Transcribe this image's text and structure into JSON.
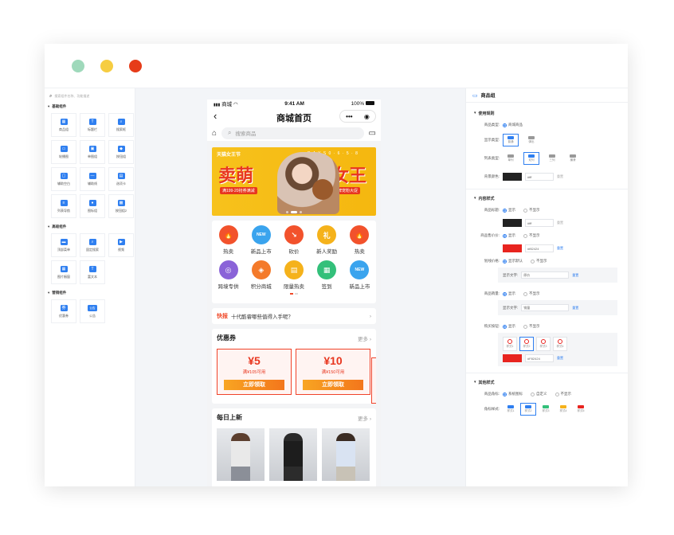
{
  "window": {
    "traffic_lights": [
      "#9fd9bb",
      "#f6cd42",
      "#e63c19"
    ]
  },
  "left_panel": {
    "search_placeholder": "搜索组件名称、功能描述",
    "sections": [
      {
        "title": "基础组件",
        "items": [
          {
            "label": "商品组",
            "glyph": "▦"
          },
          {
            "label": "标题栏",
            "glyph": "T"
          },
          {
            "label": "搜索框",
            "glyph": "⌕"
          },
          {
            "label": "轮播图",
            "glyph": "▭"
          },
          {
            "label": "单图组",
            "glyph": "▣"
          },
          {
            "label": "按钮组",
            "glyph": "◆"
          },
          {
            "label": "辅助空白",
            "glyph": "▢"
          },
          {
            "label": "辅助线",
            "glyph": "―"
          },
          {
            "label": "选项卡",
            "glyph": "▤"
          },
          {
            "label": "列表导航",
            "glyph": "≡"
          },
          {
            "label": "图标组",
            "glyph": "●"
          },
          {
            "label": "按钮组2",
            "glyph": "▩"
          }
        ]
      },
      {
        "title": "高级组件",
        "items": [
          {
            "label": "顶部菜单",
            "glyph": "▬"
          },
          {
            "label": "固定搜索",
            "glyph": "⌕"
          },
          {
            "label": "视频",
            "glyph": "▶"
          },
          {
            "label": "图片橱窗",
            "glyph": "▦"
          },
          {
            "label": "富文本",
            "glyph": "T"
          }
        ]
      },
      {
        "title": "营销组件",
        "items": [
          {
            "label": "优惠券",
            "glyph": "券"
          },
          {
            "label": "公告",
            "glyph": "公告"
          }
        ]
      }
    ]
  },
  "phone": {
    "status": {
      "carrier": "商城",
      "time": "9:41 AM",
      "battery": "100%"
    },
    "nav_title": "商城首页",
    "search_placeholder": "搜索商品",
    "banner": {
      "brand": "天猫女王节",
      "dates": "D A Y S 0 · 6 · 5 · 8",
      "big_left": "卖萌",
      "big_right": "女王",
      "tag_left": "满199-20抢券满减",
      "tag_right": "大牌宠粉大促"
    },
    "icons": [
      [
        {
          "label": "热卖",
          "color": "#f2522c",
          "glyph": "🔥"
        },
        {
          "label": "新品上市",
          "color": "#3aa4ee",
          "glyph": "NEW"
        },
        {
          "label": "砍价",
          "color": "#f2522c",
          "glyph": "↘"
        },
        {
          "label": "新人奖励",
          "color": "#f5b21b",
          "glyph": "礼"
        },
        {
          "label": "热卖",
          "color": "#f2522c",
          "glyph": "🔥"
        }
      ],
      [
        {
          "label": "跨境专供",
          "color": "#8a63d8",
          "glyph": "◎"
        },
        {
          "label": "积分商城",
          "color": "#f47a2a",
          "glyph": "◈"
        },
        {
          "label": "限量热卖",
          "color": "#f5b21b",
          "glyph": "▤"
        },
        {
          "label": "签到",
          "color": "#33c07a",
          "glyph": "▦"
        },
        {
          "label": "新品上市",
          "color": "#3aa4ee",
          "glyph": "NEW"
        }
      ]
    ],
    "notice": {
      "tag": "快报",
      "text": "十代酷睿哪些值得入手呢？"
    },
    "coupon_section": {
      "title": "优惠券",
      "more": "更多",
      "coupons": [
        {
          "amount": "¥5",
          "condition": "满¥105可用",
          "button": "立即领取"
        },
        {
          "amount": "¥10",
          "condition": "满¥150可用",
          "button": "立即领取"
        }
      ]
    },
    "new_section": {
      "title": "每日上新",
      "more": "更多"
    }
  },
  "right_panel": {
    "title": "商品组",
    "sections": {
      "usage": "使用规则",
      "content": "内容样式",
      "other": "其他样式"
    },
    "rows": {
      "goods_type": {
        "label": "商品类型:",
        "option": "商城商品"
      },
      "display_type": {
        "label": "显示类型:",
        "options": [
          "普通",
          "弹出"
        ]
      },
      "list_type": {
        "label": "列表类型:",
        "options": [
          "单列",
          "双列",
          "三列",
          "横滑"
        ]
      },
      "bg_color": {
        "label": "背景颜色:",
        "hex": "#fff",
        "reset": "重置"
      },
      "goods_title": {
        "label": "商品标题:",
        "options": [
          "显示",
          "不显示"
        ],
        "hex": "#fff",
        "reset": "重置"
      },
      "goods_price": {
        "label": "商品售价价:",
        "options": [
          "显示",
          "不显示"
        ],
        "hex": "#f82424",
        "reset": "重置"
      },
      "origin_price": {
        "label": "划线价格:",
        "options": [
          "显示默认",
          "不显示"
        ],
        "text_label": "显示文字:",
        "text_value": "原价",
        "reset": "重置"
      },
      "sales": {
        "label": "商品销量:",
        "options": [
          "显示",
          "不显示"
        ],
        "text_label": "显示文字:",
        "text_value": "销量",
        "reset": "重置"
      },
      "buy_button": {
        "label": "购买按钮:",
        "options": [
          "显示",
          "不显示"
        ],
        "styles": [
          "样式1",
          "样式2",
          "样式3",
          "样式4"
        ],
        "hex": "#F82424",
        "reset": "重置"
      },
      "corner": {
        "label": "商品角标:",
        "options": [
          "系统图标",
          "自定义",
          "不显示"
        ]
      },
      "corner_style": {
        "label": "角标样式:",
        "styles": [
          "样式1",
          "样式2",
          "样式3",
          "样式4",
          "样式5"
        ]
      }
    },
    "accent": "#2f7ff0"
  }
}
